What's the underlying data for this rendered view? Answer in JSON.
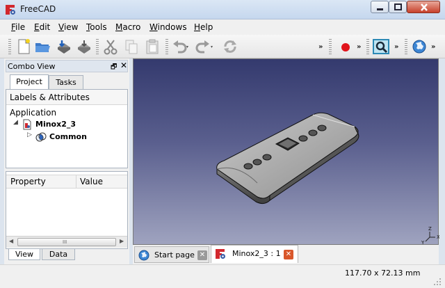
{
  "window": {
    "title": "FreeCAD",
    "icon": "freecad-app-icon",
    "controls": [
      "minimize",
      "maximize",
      "close"
    ]
  },
  "menu": [
    {
      "label": "File",
      "mnemonic": "F",
      "rest": "ile"
    },
    {
      "label": "Edit",
      "mnemonic": "E",
      "rest": "dit"
    },
    {
      "label": "View",
      "mnemonic": "V",
      "rest": "iew"
    },
    {
      "label": "Tools",
      "mnemonic": "T",
      "rest": "ools"
    },
    {
      "label": "Macro",
      "mnemonic": "M",
      "rest": "acro"
    },
    {
      "label": "Windows",
      "mnemonic": "W",
      "rest": "indows"
    },
    {
      "label": "Help",
      "mnemonic": "H",
      "rest": "elp"
    }
  ],
  "toolbar": {
    "icons": [
      "new-document-icon",
      "open-folder-icon",
      "save-icon",
      "save-as-icon",
      "cut-icon",
      "copy-icon",
      "paste-icon",
      "undo-icon",
      "redo-icon",
      "refresh-icon",
      "record-macro-icon",
      "view-fit-icon",
      "web-globe-icon"
    ],
    "overflow": "»"
  },
  "combo_view": {
    "title": "Combo View",
    "float_glyph": "🗗",
    "close_glyph": "✕",
    "tabs": [
      "Project",
      "Tasks"
    ],
    "active_tab": "Project",
    "labels_header": "Labels & Attributes",
    "tree": {
      "root": "Application",
      "document": "Minox2_3",
      "child": "Common",
      "expanded_glyph": "◢",
      "collapsed_glyph": "▷"
    },
    "property_columns": [
      "Property",
      "Value"
    ],
    "scroll_grip": "III",
    "bottom_tabs": [
      "View",
      "Data"
    ],
    "active_bottom_tab": "View"
  },
  "view3d": {
    "background_top": "#343a6e",
    "background_bottom": "#9fa3bf",
    "axis_labels": [
      "X",
      "Y",
      "Z"
    ]
  },
  "doc_tabs": [
    {
      "label": "Start page",
      "icon": "globe-icon",
      "active": false
    },
    {
      "label": "Minox2_3 : 1",
      "icon": "freecad-app-icon",
      "active": true
    }
  ],
  "doc_tab_close_glyph": "✕",
  "status": {
    "dimensions": "117.70 x 72.13 mm"
  }
}
